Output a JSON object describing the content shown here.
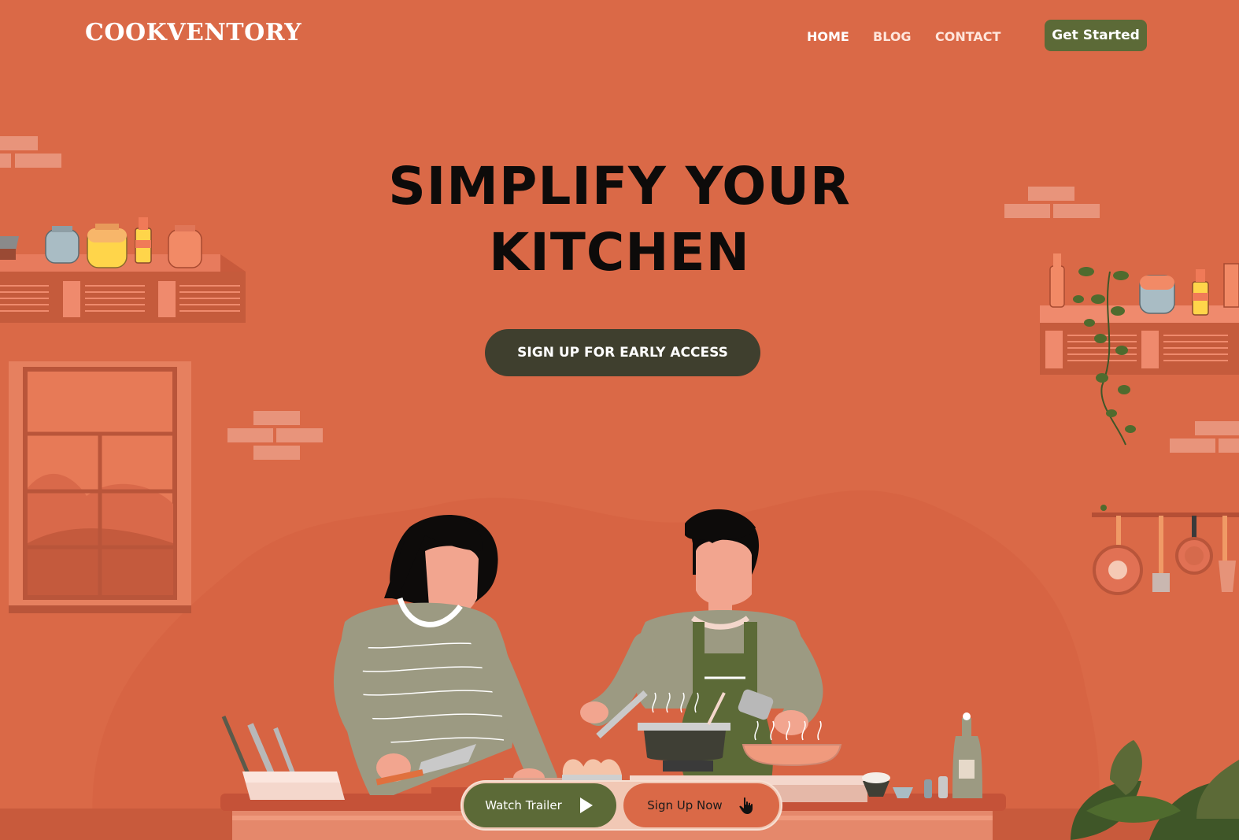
{
  "brand": {
    "logo": "COOKVENTORY"
  },
  "nav": {
    "items": [
      "HOME",
      "BLOG",
      "CONTACT"
    ],
    "cta": "Get Started"
  },
  "hero": {
    "title_line1": "SIMPLIFY YOUR",
    "title_line2": "KITCHEN",
    "cta": "SIGN UP FOR EARLY ACCESS"
  },
  "actions": {
    "watch_label": "Watch Trailer",
    "watch_icon": "play-icon",
    "signup_label": "Sign Up Now",
    "signup_icon": "hand-pointer-icon"
  },
  "colors": {
    "background": "#da6947",
    "primary_green": "#5c6a37",
    "dark_button": "#3f3f2e",
    "title": "#0d0b0a"
  }
}
